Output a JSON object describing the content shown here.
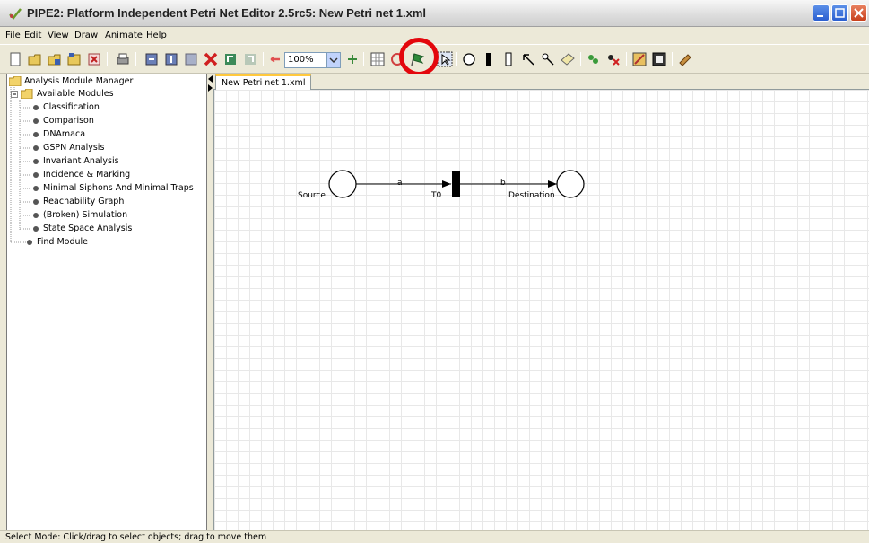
{
  "window": {
    "title": "PIPE2: Platform Independent Petri Net Editor 2.5rc5: New Petri net 1.xml"
  },
  "menu": [
    "File",
    "Edit",
    "View",
    "Draw",
    "Animate",
    "Help"
  ],
  "toolbar": {
    "zoom_value": "100%",
    "icons": [
      "new-file-icon",
      "open-file-icon",
      "save-icon",
      "save-as-icon",
      "close-file-icon",
      "print-icon",
      "cut-icon",
      "copy-icon",
      "paste-icon",
      "delete-icon",
      "undo-icon",
      "redo-icon",
      "zoom-out-icon",
      "zoom-in-icon",
      "grid-icon",
      "drag-icon",
      "animation-mode-flag-icon",
      "select-icon",
      "place-icon",
      "immediate-transition-icon",
      "timed-transition-icon",
      "arc-icon",
      "inhibitor-arc-icon",
      "annotation-icon",
      "add-token-icon",
      "delete-token-icon",
      "rate-parameter-icon",
      "marking-parameter-icon",
      "fast-draw-icon"
    ],
    "highlighted_tool": "animation-mode-flag-icon"
  },
  "tree": {
    "root": "Analysis Module Manager",
    "group": "Available Modules",
    "modules": [
      "Classification",
      "Comparison",
      "DNAmaca",
      "GSPN Analysis",
      "Invariant Analysis",
      "Incidence & Marking",
      "Minimal Siphons And Minimal Traps",
      "Reachability Graph",
      "(Broken) Simulation",
      "State Space Analysis"
    ],
    "find": "Find Module"
  },
  "tab": {
    "label": "New Petri net 1.xml"
  },
  "net": {
    "place_source": "Source",
    "place_destination": "Destination",
    "transition": "T0",
    "arc_a": "a",
    "arc_b": "b"
  },
  "status": "Select Mode: Click/drag to select objects; drag to move them",
  "colors": {
    "highlight_ring": "#e3070d",
    "title_bar": "#dcdcdc",
    "chrome": "#ece9d8"
  }
}
